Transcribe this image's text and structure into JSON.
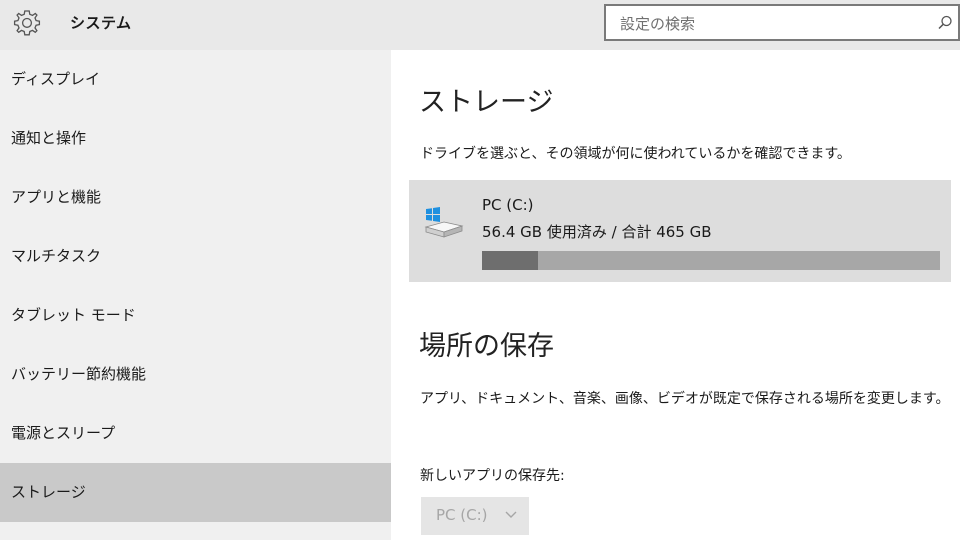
{
  "header": {
    "title": "システム",
    "search": {
      "placeholder": "設定の検索"
    },
    "icons": {
      "settings": "gear-icon",
      "search": "search-icon"
    }
  },
  "sidebar": {
    "items": [
      {
        "label": "ディスプレイ",
        "active": false
      },
      {
        "label": "通知と操作",
        "active": false
      },
      {
        "label": "アプリと機能",
        "active": false
      },
      {
        "label": "マルチタスク",
        "active": false
      },
      {
        "label": "タブレット モード",
        "active": false
      },
      {
        "label": "バッテリー節約機能",
        "active": false
      },
      {
        "label": "電源とスリープ",
        "active": false
      },
      {
        "label": "ストレージ",
        "active": true
      }
    ]
  },
  "main": {
    "storage_title": "ストレージ",
    "storage_desc": "ドライブを選ぶと、その領域が何に使われているかを確認できます。",
    "drive": {
      "name": "PC (C:)",
      "usage_text": "56.4 GB 使用済み / 合計 465 GB",
      "used_gb": 56.4,
      "total_gb": 465,
      "icon": "windows-drive-icon"
    },
    "save_title": "場所の保存",
    "save_desc": "アプリ、ドキュメント、音楽、画像、ビデオが既定で保存される場所を変更します。",
    "new_apps_label": "新しいアプリの保存先:",
    "new_apps_value": "PC (C:)"
  },
  "colors": {
    "sidebar_bg": "#f0f0f0",
    "active_item": "#c9c9c9",
    "drive_tile": "#dddddd",
    "bar_used": "#6e6e6e",
    "bar_track": "#a7a7a7",
    "windows_logo": "#1e90e0"
  }
}
